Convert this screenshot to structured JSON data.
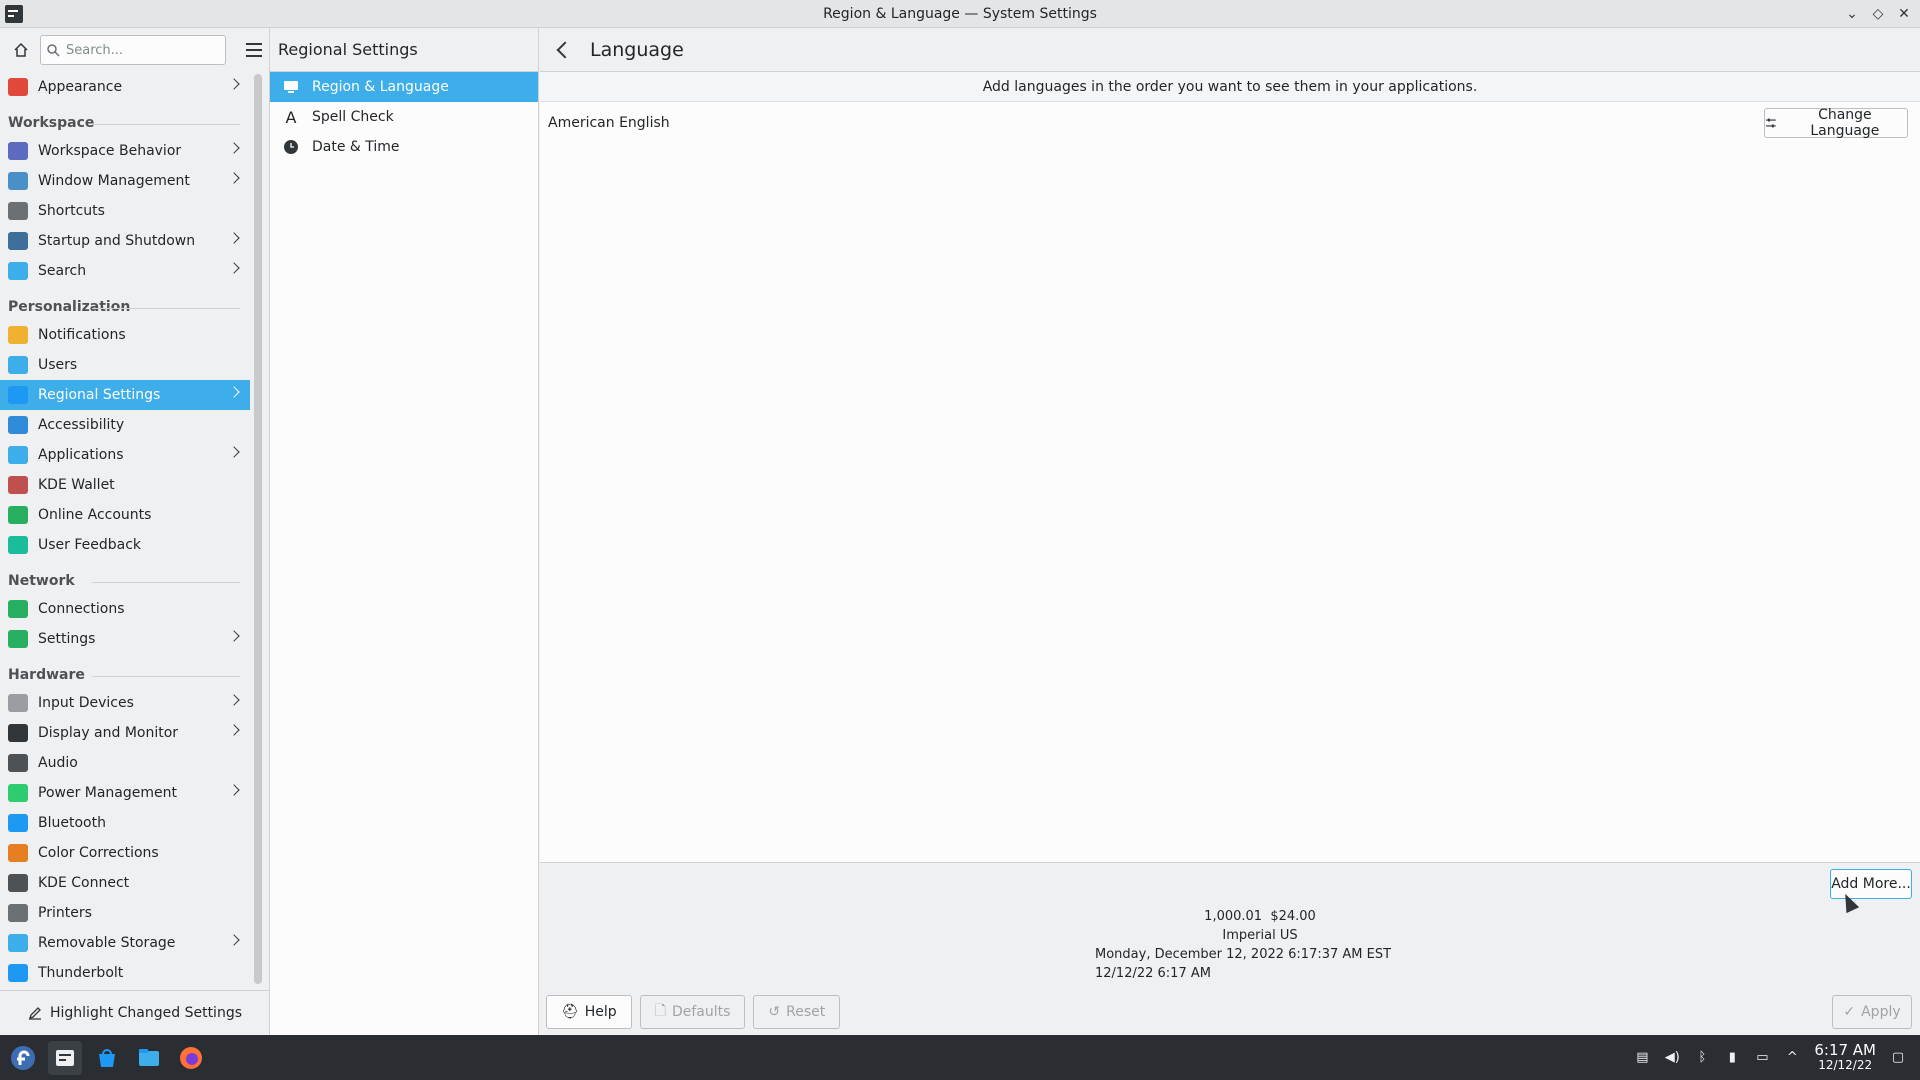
{
  "window": {
    "title": "Region & Language — System Settings",
    "controls": [
      "minimize",
      "maximize",
      "close"
    ]
  },
  "sidebar": {
    "search_placeholder": "Search...",
    "items": [
      {
        "type": "item",
        "label": "Appearance",
        "icon": "appearance-icon",
        "color": "#e0483a",
        "chevron": true
      },
      {
        "type": "header",
        "label": "Workspace"
      },
      {
        "type": "item",
        "label": "Workspace Behavior",
        "icon": "workspace-behavior-icon",
        "color": "#5c6bc0",
        "chevron": true
      },
      {
        "type": "item",
        "label": "Window Management",
        "icon": "window-management-icon",
        "color": "#4a90c8",
        "chevron": true
      },
      {
        "type": "item",
        "label": "Shortcuts",
        "icon": "keyboard-icon",
        "color": "#6b7075",
        "chevron": false
      },
      {
        "type": "item",
        "label": "Startup and Shutdown",
        "icon": "startup-shutdown-icon",
        "color": "#3d6f9a",
        "chevron": true
      },
      {
        "type": "item",
        "label": "Search",
        "icon": "search-icon",
        "color": "#3daee9",
        "chevron": true
      },
      {
        "type": "header",
        "label": "Personalization"
      },
      {
        "type": "item",
        "label": "Notifications",
        "icon": "bell-icon",
        "color": "#f0b030",
        "chevron": false
      },
      {
        "type": "item",
        "label": "Users",
        "icon": "users-icon",
        "color": "#3daee9",
        "chevron": false
      },
      {
        "type": "item",
        "label": "Regional Settings",
        "icon": "regional-settings-icon",
        "color": "#1d99f3",
        "chevron": true,
        "active": true
      },
      {
        "type": "item",
        "label": "Accessibility",
        "icon": "accessibility-icon",
        "color": "#2f8bd8",
        "chevron": false
      },
      {
        "type": "item",
        "label": "Applications",
        "icon": "applications-icon",
        "color": "#3daee9",
        "chevron": true
      },
      {
        "type": "item",
        "label": "KDE Wallet",
        "icon": "wallet-icon",
        "color": "#c05050",
        "chevron": false
      },
      {
        "type": "item",
        "label": "Online Accounts",
        "icon": "online-accounts-icon",
        "color": "#27ae60",
        "chevron": false
      },
      {
        "type": "item",
        "label": "User Feedback",
        "icon": "feedback-icon",
        "color": "#1abc9c",
        "chevron": false
      },
      {
        "type": "header",
        "label": "Network"
      },
      {
        "type": "item",
        "label": "Connections",
        "icon": "connections-icon",
        "color": "#27ae60",
        "chevron": false
      },
      {
        "type": "item",
        "label": "Settings",
        "icon": "network-settings-icon",
        "color": "#27ae60",
        "chevron": true
      },
      {
        "type": "header",
        "label": "Hardware"
      },
      {
        "type": "item",
        "label": "Input Devices",
        "icon": "mouse-icon",
        "color": "#9a9ea2",
        "chevron": true
      },
      {
        "type": "item",
        "label": "Display and Monitor",
        "icon": "monitor-icon",
        "color": "#31363b",
        "chevron": true
      },
      {
        "type": "item",
        "label": "Audio",
        "icon": "speaker-icon",
        "color": "#4d5256",
        "chevron": false
      },
      {
        "type": "item",
        "label": "Power Management",
        "icon": "power-icon",
        "color": "#2ecc71",
        "chevron": true
      },
      {
        "type": "item",
        "label": "Bluetooth",
        "icon": "bluetooth-icon",
        "color": "#1d99f3",
        "chevron": false
      },
      {
        "type": "item",
        "label": "Color Corrections",
        "icon": "color-corrections-icon",
        "color": "#e67e22",
        "chevron": false
      },
      {
        "type": "item",
        "label": "KDE Connect",
        "icon": "phone-icon",
        "color": "#4d5256",
        "chevron": false
      },
      {
        "type": "item",
        "label": "Printers",
        "icon": "printer-icon",
        "color": "#6b7075",
        "chevron": false
      },
      {
        "type": "item",
        "label": "Removable Storage",
        "icon": "usb-storage-icon",
        "color": "#3daee9",
        "chevron": true
      },
      {
        "type": "item",
        "label": "Thunderbolt",
        "icon": "thunderbolt-icon",
        "color": "#1d99f3",
        "chevron": false
      }
    ],
    "highlight_label": "Highlight Changed Settings"
  },
  "middle": {
    "title": "Regional Settings",
    "items": [
      {
        "label": "Region & Language",
        "icon": "region-language-icon",
        "active": true
      },
      {
        "label": "Spell Check",
        "icon": "spell-check-icon",
        "active": false
      },
      {
        "label": "Date & Time",
        "icon": "clock-icon",
        "active": false
      }
    ]
  },
  "main": {
    "title": "Language",
    "info": "Add languages in the order you want to see them in your applications.",
    "languages": [
      "American English"
    ],
    "change_language_label": "Change Language",
    "add_more_label": "Add More...",
    "preview": {
      "numbers": "1,000.01  $24.00",
      "measurement": "Imperial US",
      "long_date": "Monday, December 12, 2022 6:17:37 AM EST",
      "short_date": "12/12/22 6:17 AM"
    },
    "footer": {
      "help": "Help",
      "defaults": "Defaults",
      "reset": "Reset",
      "apply": "Apply"
    }
  },
  "taskbar": {
    "time": "6:17 AM",
    "date": "12/12/22"
  },
  "colors": {
    "accent": "#3daee9",
    "window_bg": "#eff0f1",
    "view_bg": "#fcfcfc",
    "taskbar_bg": "#2a2e32"
  }
}
